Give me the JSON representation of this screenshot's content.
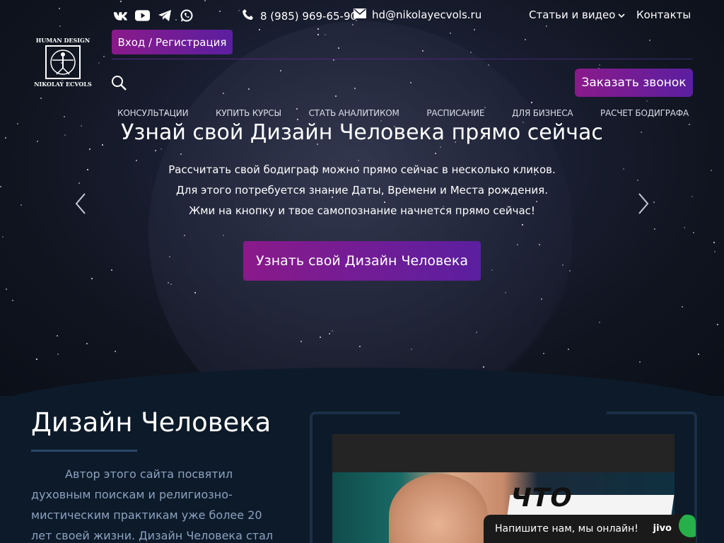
{
  "logo": {
    "top": "HUMAN DESIGN",
    "bottom": "NIKOLAY ECVOLS"
  },
  "socials": [
    "vk-icon",
    "youtube-icon",
    "telegram-icon",
    "whatsapp-icon"
  ],
  "contacts": {
    "phone": "8 (985) 969-65-90",
    "email": "hd@nikolayecvols.ru"
  },
  "top_menu": {
    "articles": "Статьи и видео",
    "contacts": "Контакты"
  },
  "login_label": "Вход / Регистрация",
  "call_label": "Заказать звонок",
  "nav": [
    "КОНСУЛЬТАЦИИ",
    "КУПИТЬ КУРСЫ",
    "СТАТЬ АНАЛИТИКОМ",
    "РАСПИСАНИЕ",
    "ДЛЯ БИЗНЕСА",
    "РАСЧЕТ БОДИГРАФА"
  ],
  "hero": {
    "title": "Узнай свой Дизайн Человека прямо сейчас",
    "lines": [
      "Рассчитать свой бодиграф можно прямо сейчас в несколько кликов.",
      "Для этого потребуется знание Даты, Времени и Места рождения.",
      "Жми на кнопку и твое самопознание начнется прямо сейчас!"
    ],
    "cta": "Узнать свой Дизайн Человека"
  },
  "about": {
    "title": "Дизайн Человека",
    "text": "Автор этого сайта посвятил духовным поискам и религиозно-мистическим практикам уже более 20 лет своей жизни. Дизайн Человека стал конечной системой"
  },
  "video": {
    "caption": "ЧТО ТАКОЕ"
  },
  "chat": {
    "label": "Напишите нам, мы онлайн!",
    "brand": "jivo"
  },
  "colors": {
    "accent_from": "#8a1a8a",
    "accent_to": "#5b1fa0",
    "section_bg": "#0d1a29",
    "body_text": "#8ca2c0"
  }
}
